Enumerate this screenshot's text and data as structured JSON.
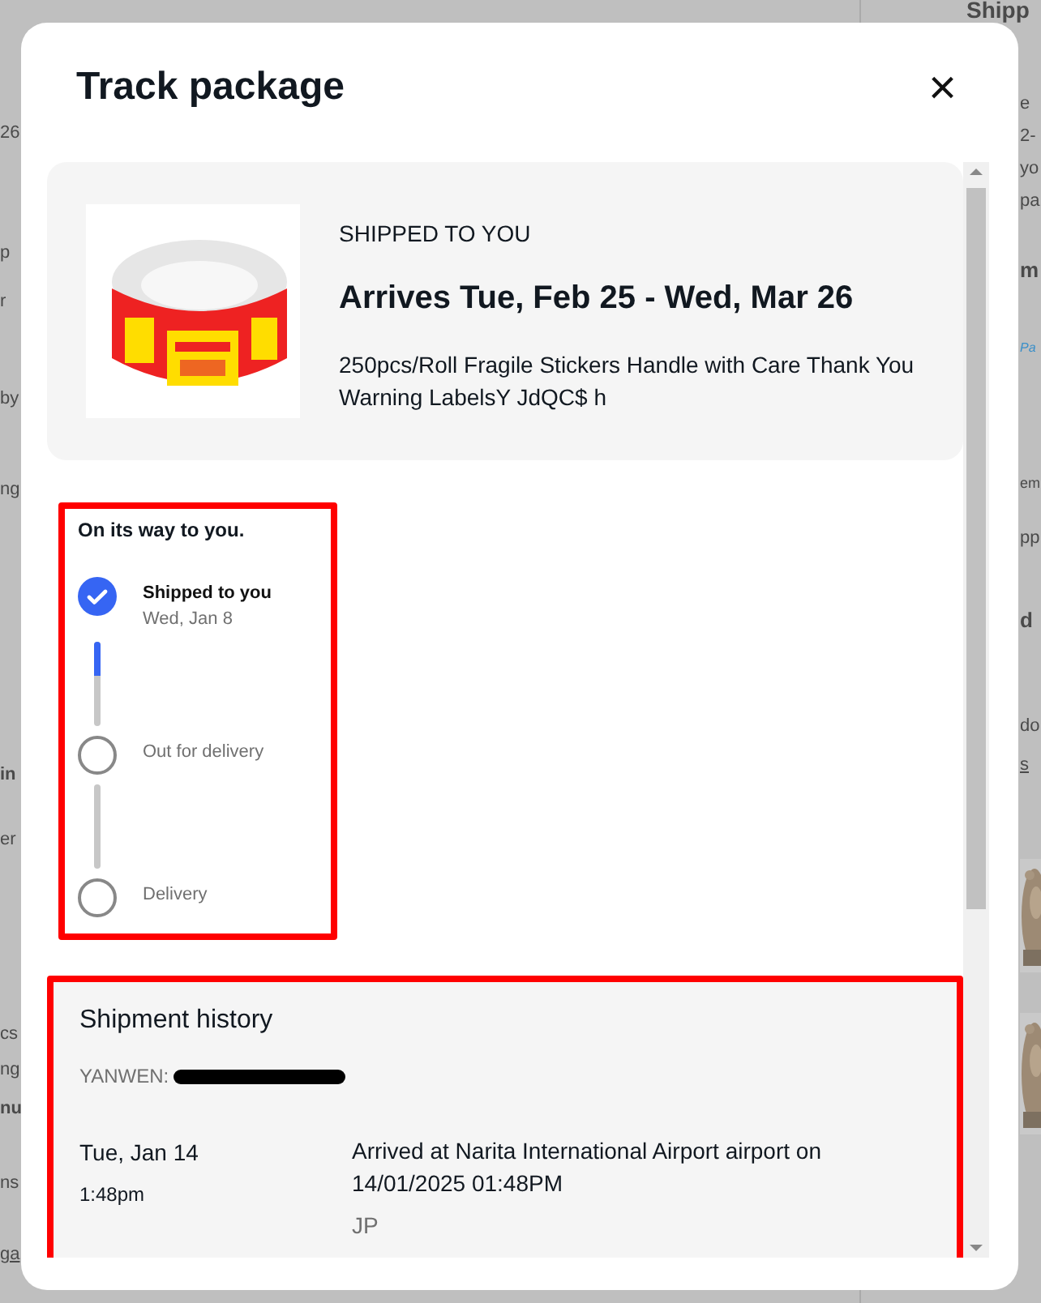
{
  "background": {
    "left_fragments": [
      "26",
      "p",
      "r",
      "by",
      "ng",
      "in",
      "er",
      "cs",
      "ng",
      "nu",
      "ns",
      "ga"
    ],
    "right_fragments": [
      "Shipp",
      "e",
      "2-",
      "yo",
      "pa",
      "m",
      "Pa",
      "em",
      "pp",
      "d",
      "do",
      "s"
    ]
  },
  "dialog": {
    "title": "Track package",
    "close_label": "×"
  },
  "item": {
    "status": "SHIPPED TO YOU",
    "arrival": "Arrives Tue, Feb 25 - Wed, Mar 26",
    "name": "250pcs/Roll Fragile Stickers Handle with Care Thank You Warning LabelsY JdQC$ h"
  },
  "progress": {
    "heading": "On its way to you.",
    "highlighted": true,
    "steps": [
      {
        "label": "Shipped to you",
        "date": "Wed, Jan 8",
        "done": true,
        "level": 0.4
      },
      {
        "label": "Out for delivery",
        "done": false
      },
      {
        "label": "Delivery",
        "done": false
      }
    ]
  },
  "history": {
    "heading": "Shipment history",
    "highlighted": true,
    "carrier": "YANWEN:",
    "tracking_redacted": true,
    "events": [
      {
        "date": "Tue, Jan 14",
        "time": "1:48pm",
        "description": "Arrived at Narita International Airport airport on 14/01/2025 01:48PM",
        "location": "JP"
      }
    ]
  }
}
